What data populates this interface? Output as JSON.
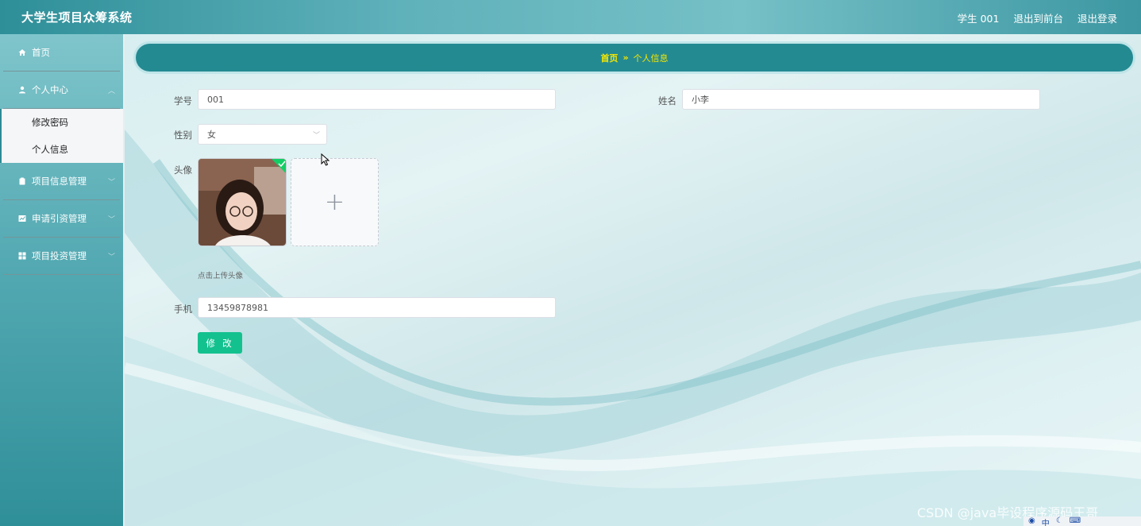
{
  "header": {
    "title": "大学生项目众筹系统",
    "user_label": "学生 001",
    "front_link": "退出到前台",
    "logout_link": "退出登录"
  },
  "sidebar": {
    "items": [
      {
        "label": "首页",
        "icon": "home-icon"
      },
      {
        "label": "个人中心",
        "icon": "user-icon"
      },
      {
        "label": "项目信息管理",
        "icon": "clipboard-icon"
      },
      {
        "label": "申请引资管理",
        "icon": "chart-icon"
      },
      {
        "label": "项目投资管理",
        "icon": "grid-icon"
      }
    ],
    "submenu": [
      {
        "label": "修改密码"
      },
      {
        "label": "个人信息"
      }
    ]
  },
  "breadcrumb": {
    "home": "首页",
    "separator": "»",
    "current": "个人信息"
  },
  "form": {
    "student_id_label": "学号",
    "student_id_value": "001",
    "name_label": "姓名",
    "name_value": "小李",
    "gender_label": "性别",
    "gender_value": "女",
    "avatar_label": "头像",
    "upload_tip": "点击上传头像",
    "phone_label": "手机",
    "phone_value": "13459878981",
    "submit_label": "修 改"
  },
  "watermark": "CSDN @java毕设程序源码王哥",
  "taskbar": {
    "ime_label": "中"
  }
}
